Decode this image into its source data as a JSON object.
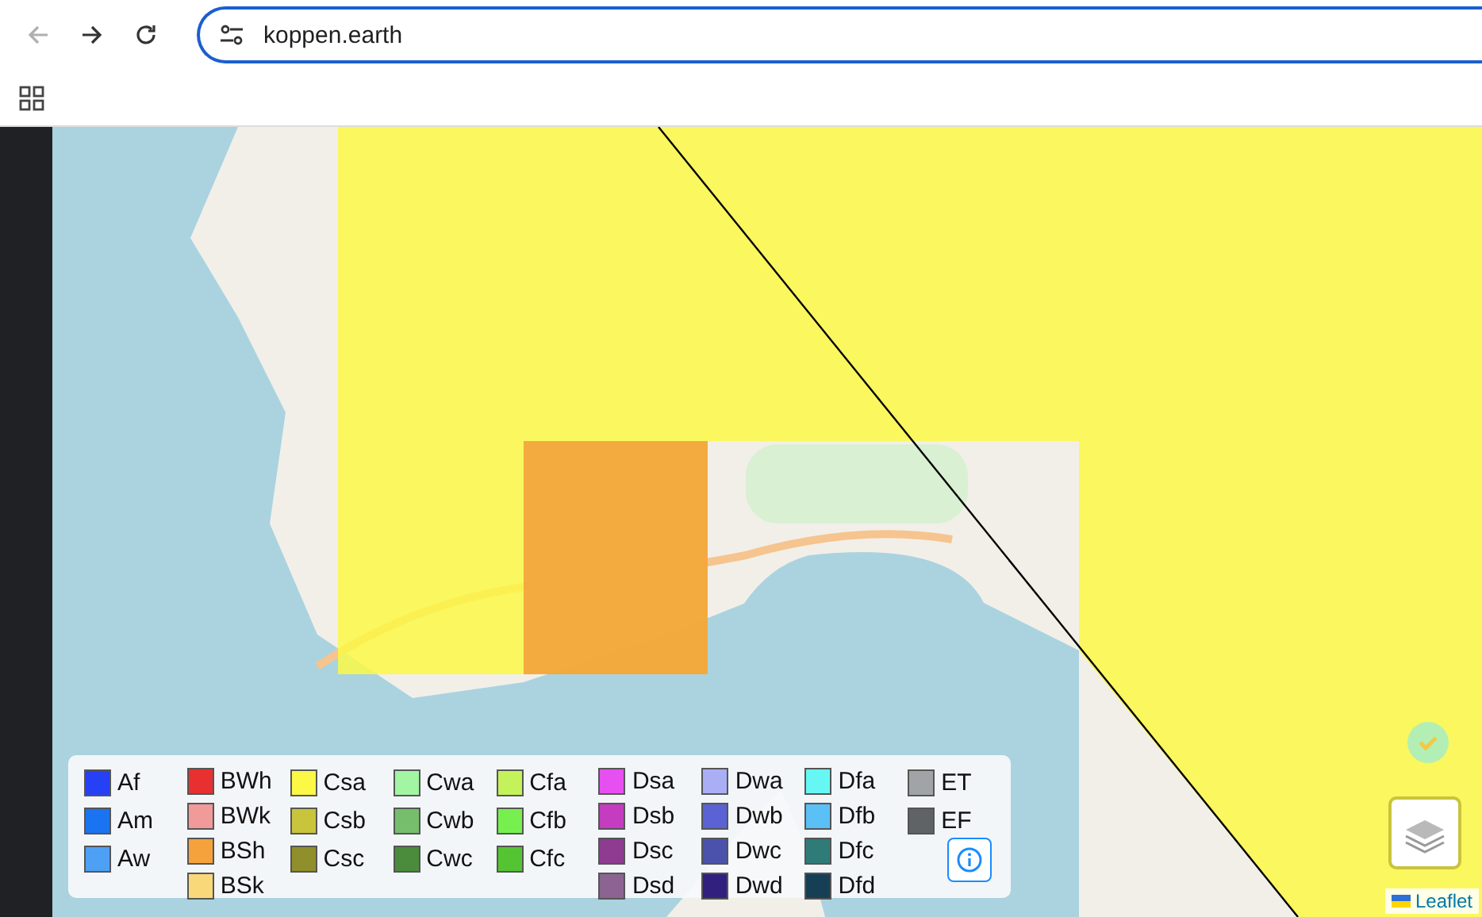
{
  "browser": {
    "nav_buttons": [
      {
        "kind": "back",
        "disabled": true
      },
      {
        "kind": "forward",
        "disabled": false
      },
      {
        "kind": "reload",
        "disabled": false
      }
    ],
    "address": "koppen.earth"
  },
  "legend": {
    "columns": [
      [
        {
          "label": "Af",
          "color": "#2540f5"
        },
        {
          "label": "Am",
          "color": "#1a73f0"
        },
        {
          "label": "Aw",
          "color": "#4ea0f5"
        }
      ],
      [
        {
          "label": "BWh",
          "color": "#e83030"
        },
        {
          "label": "BWk",
          "color": "#f09a9a"
        },
        {
          "label": "BSh",
          "color": "#f5a23c"
        },
        {
          "label": "BSk",
          "color": "#f9d87a"
        }
      ],
      [
        {
          "label": "Csa",
          "color": "#fbf846"
        },
        {
          "label": "Csb",
          "color": "#c8c43c"
        },
        {
          "label": "Csc",
          "color": "#8f8f2c"
        }
      ],
      [
        {
          "label": "Cwa",
          "color": "#a2f5a2"
        },
        {
          "label": "Cwb",
          "color": "#76be6c"
        },
        {
          "label": "Cwc",
          "color": "#4a8c3c"
        }
      ],
      [
        {
          "label": "Cfa",
          "color": "#c3f25a"
        },
        {
          "label": "Cfb",
          "color": "#77f04f"
        },
        {
          "label": "Cfc",
          "color": "#55c432"
        }
      ],
      [
        {
          "label": "Dsa",
          "color": "#e64ff0"
        },
        {
          "label": "Dsb",
          "color": "#c43cbf"
        },
        {
          "label": "Dsc",
          "color": "#8d3c90"
        },
        {
          "label": "Dsd",
          "color": "#8b6492"
        }
      ],
      [
        {
          "label": "Dwa",
          "color": "#aaaef5"
        },
        {
          "label": "Dwb",
          "color": "#5b62d4"
        },
        {
          "label": "Dwc",
          "color": "#4b52ac"
        },
        {
          "label": "Dwd",
          "color": "#32207e"
        }
      ],
      [
        {
          "label": "Dfa",
          "color": "#66f7f5"
        },
        {
          "label": "Dfb",
          "color": "#5ac0f5"
        },
        {
          "label": "Dfc",
          "color": "#2e7b78"
        },
        {
          "label": "Dfd",
          "color": "#163f55"
        }
      ],
      [
        {
          "label": "ET",
          "color": "#a0a4a6"
        },
        {
          "label": "EF",
          "color": "#5f6365"
        }
      ]
    ]
  },
  "attribution": "Leaflet"
}
